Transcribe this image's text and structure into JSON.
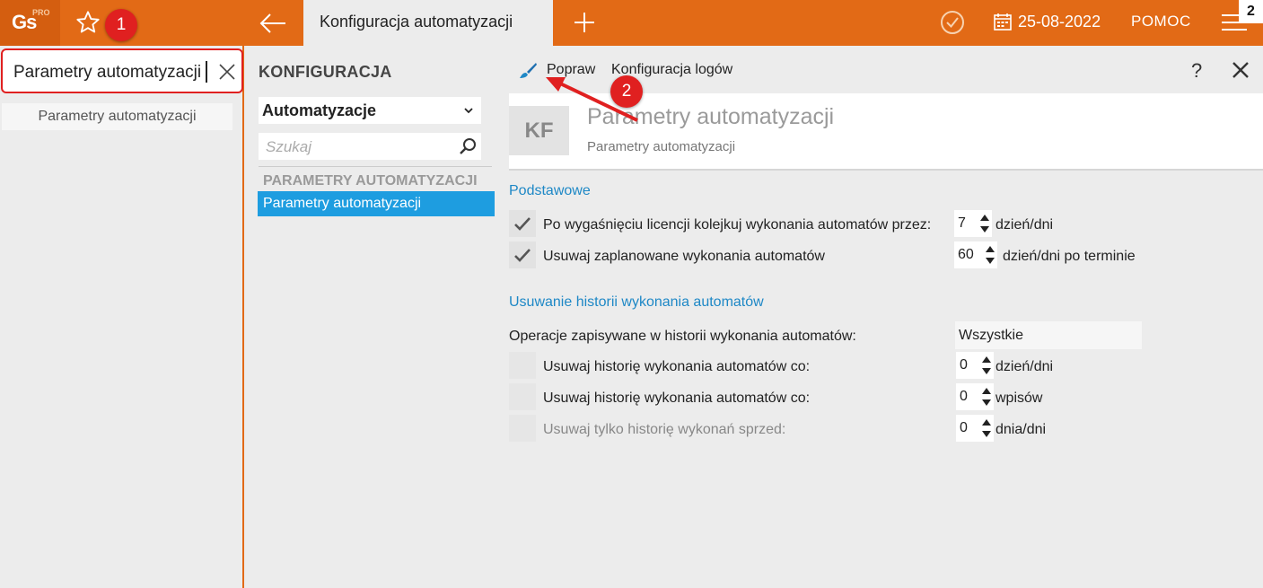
{
  "topbar": {
    "logo_text": "Gs",
    "logo_sup": "PRO",
    "tab_title": "Konfiguracja automatyzacji",
    "date": "25-08-2022",
    "help_label": "POMOC",
    "corner_number": "2",
    "accent_color": "#e26a16"
  },
  "left": {
    "search_value": "Parametry automatyzacji",
    "results": [
      "Parametry automatyzacji"
    ]
  },
  "middle": {
    "title": "KONFIGURACJA",
    "select_value": "Automatyzacje",
    "search_placeholder": "Szukaj",
    "group_label": "PARAMETRY AUTOMATYZACJI",
    "selected_item": "Parametry automatyzacji"
  },
  "toolbar": {
    "edit_label": "Popraw",
    "log_config_label": "Konfiguracja logów",
    "help_label": "?"
  },
  "header": {
    "avatar_text": "KF",
    "title": "Parametry automatyzacji",
    "subtitle": "Parametry automatyzacji"
  },
  "form": {
    "section1_title": "Podstawowe",
    "row1": {
      "label": "Po wygaśnięciu licencji kolejkuj wykonania automatów przez:",
      "checked": true,
      "value": "7",
      "unit": "dzień/dni"
    },
    "row2": {
      "label": "Usuwaj zaplanowane wykonania automatów",
      "checked": true,
      "value": "60",
      "unit": "dzień/dni po terminie"
    },
    "section2_title": "Usuwanie historii wykonania automatów",
    "ops_label": "Operacje zapisywane w historii wykonania automatów:",
    "ops_value": "Wszystkie",
    "row3": {
      "label": "Usuwaj historię wykonania automatów co:",
      "checked": false,
      "value": "0",
      "unit": "dzień/dni"
    },
    "row4": {
      "label": "Usuwaj historię wykonania automatów co:",
      "checked": false,
      "value": "0",
      "unit": "wpisów"
    },
    "row5": {
      "label": "Usuwaj tylko historię wykonań sprzed:",
      "checked": false,
      "value": "0",
      "unit": "dnia/dni"
    }
  },
  "annotations": {
    "step1": "1",
    "step2": "2",
    "color": "#e02020"
  }
}
